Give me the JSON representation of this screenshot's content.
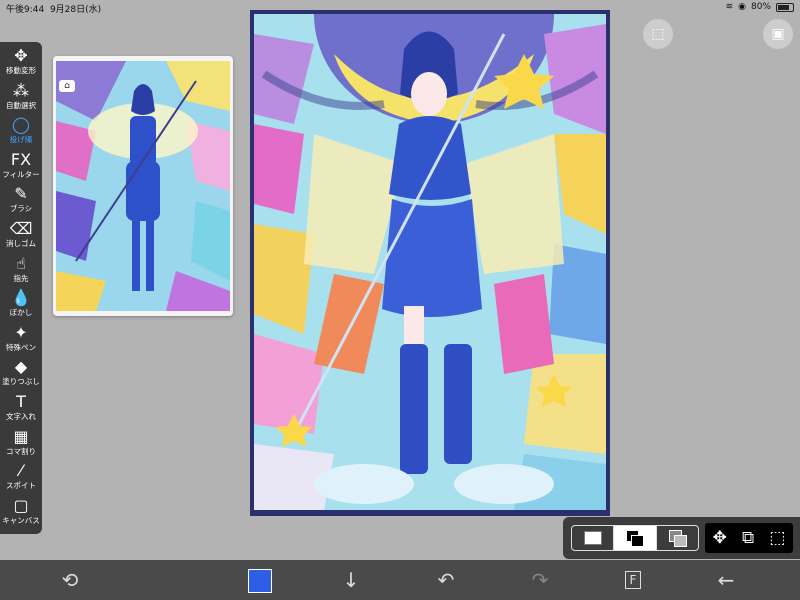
{
  "status": {
    "time": "午後9:44",
    "date": "9月28日(水)",
    "battery": "80%",
    "battery_level": 0.8,
    "wifi_icon": "wifi-icon",
    "lock_icon": "orientation-lock-icon"
  },
  "tools": [
    {
      "id": "move",
      "label": "移動変形",
      "icon": "✥",
      "icon_name": "move-icon"
    },
    {
      "id": "auto-select",
      "label": "自動選択",
      "icon": "⁂",
      "icon_name": "magic-wand-icon"
    },
    {
      "id": "lasso",
      "label": "投げ縄",
      "icon": "◯",
      "icon_name": "lasso-icon",
      "active": true
    },
    {
      "id": "filter",
      "label": "フィルター",
      "icon": "FX",
      "icon_name": "fx-icon"
    },
    {
      "id": "brush",
      "label": "ブラシ",
      "icon": "✎",
      "icon_name": "brush-icon"
    },
    {
      "id": "eraser",
      "label": "消しゴム",
      "icon": "⌫",
      "icon_name": "eraser-icon"
    },
    {
      "id": "smudge",
      "label": "指先",
      "icon": "☝",
      "icon_name": "finger-icon"
    },
    {
      "id": "blur",
      "label": "ぼかし",
      "icon": "💧",
      "icon_name": "blur-drop-icon"
    },
    {
      "id": "special-pen",
      "label": "特殊ペン",
      "icon": "✦",
      "icon_name": "special-pen-icon"
    },
    {
      "id": "fill",
      "label": "塗りつぶし",
      "icon": "◆",
      "icon_name": "fill-icon"
    },
    {
      "id": "text",
      "label": "文字入れ",
      "icon": "T",
      "icon_name": "text-icon"
    },
    {
      "id": "frame",
      "label": "コマ割り",
      "icon": "▦",
      "icon_name": "frame-divider-icon"
    },
    {
      "id": "eyedropper",
      "label": "スポイト",
      "icon": "⁄",
      "icon_name": "eyedropper-icon"
    },
    {
      "id": "canvas",
      "label": "キャンバス",
      "icon": "▢",
      "icon_name": "canvas-icon"
    }
  ],
  "top_right": {
    "select_icon": "⬚",
    "gallery_icon": "▣"
  },
  "bottom": {
    "color": "#2f5ee6",
    "icons": {
      "rotate": "⟲",
      "down": "↓",
      "undo": "↶",
      "redo": "↷",
      "layer": "F",
      "back": "←"
    }
  },
  "panel": {
    "tool_icons": [
      "✥",
      "⧉",
      "⬚"
    ]
  }
}
